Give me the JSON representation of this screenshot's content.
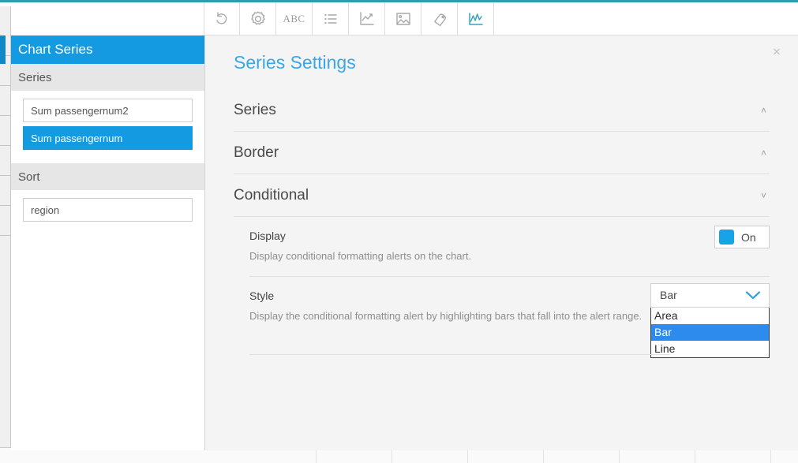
{
  "toolbar": {
    "buttons": [
      {
        "name": "undo-icon",
        "label": "Undo"
      },
      {
        "name": "gear-icon",
        "label": "Settings"
      },
      {
        "name": "text-abc-icon",
        "label": "ABC"
      },
      {
        "name": "list-icon",
        "label": "List"
      },
      {
        "name": "trend-chart-icon",
        "label": "Trend"
      },
      {
        "name": "image-icon",
        "label": "Image"
      },
      {
        "name": "tag-icon",
        "label": "Tag"
      },
      {
        "name": "line-chart-icon",
        "label": "Chart"
      }
    ]
  },
  "sidebar": {
    "title": "Chart Series",
    "sections": [
      {
        "heading": "Series",
        "fields": [
          {
            "value": "Sum passengernum2",
            "selected": false
          },
          {
            "value": "Sum passengernum",
            "selected": true
          }
        ]
      },
      {
        "heading": "Sort",
        "fields": [
          {
            "value": "region",
            "selected": false
          }
        ]
      }
    ]
  },
  "panel": {
    "title": "Series Settings",
    "close_label": "×",
    "accordion": [
      {
        "label": "Series",
        "chevron": "˄",
        "expanded": false
      },
      {
        "label": "Border",
        "chevron": "˄",
        "expanded": false
      },
      {
        "label": "Conditional",
        "chevron": "˅",
        "expanded": true
      }
    ],
    "conditional": {
      "display": {
        "label": "Display",
        "description": "Display conditional formatting alerts on the chart.",
        "toggle_state": "On"
      },
      "style": {
        "label": "Style",
        "description": "Display the conditional formatting alert by highlighting bars that fall into the alert range.",
        "selected": "Bar",
        "options": [
          "Area",
          "Bar",
          "Line"
        ]
      }
    }
  },
  "colors": {
    "accent_blue": "#149ae0",
    "title_blue": "#3aa6e8",
    "highlight_blue": "#2e8bee",
    "top_rule_teal": "#2a9fae",
    "panel_bg": "#f4f4f4"
  }
}
